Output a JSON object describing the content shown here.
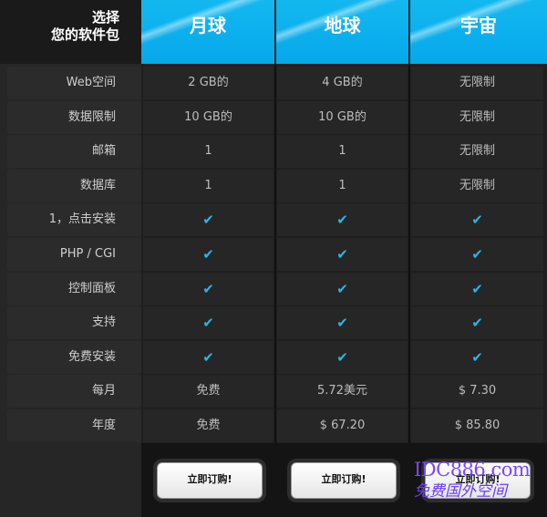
{
  "header": {
    "title_line1": "选择",
    "title_line2": "您的软件包",
    "plans": [
      "月球",
      "地球",
      "宇宙"
    ]
  },
  "rows": [
    {
      "label": "Web空间",
      "values": [
        "2 GB的",
        "4 GB的",
        "无限制"
      ]
    },
    {
      "label": "数据限制",
      "values": [
        "10 GB的",
        "10 GB的",
        "无限制"
      ]
    },
    {
      "label": "邮箱",
      "values": [
        "1",
        "1",
        "无限制"
      ]
    },
    {
      "label": "数据库",
      "values": [
        "1",
        "1",
        "无限制"
      ]
    },
    {
      "label": "1，点击安装",
      "values": [
        "✔",
        "✔",
        "✔"
      ]
    },
    {
      "label": "PHP / CGI",
      "values": [
        "✔",
        "✔",
        "✔"
      ]
    },
    {
      "label": "控制面板",
      "values": [
        "✔",
        "✔",
        "✔"
      ]
    },
    {
      "label": "支持",
      "values": [
        "✔",
        "✔",
        "✔"
      ]
    },
    {
      "label": "免费安装",
      "values": [
        "✔",
        "✔",
        "✔"
      ]
    },
    {
      "label": "每月",
      "values": [
        "免费",
        "5.72美元",
        "$ 7.30"
      ]
    },
    {
      "label": "年度",
      "values": [
        "免费",
        "$ 67.20",
        "$ 85.80"
      ]
    }
  ],
  "buttons": {
    "order_label": "立即订购!"
  },
  "watermark": {
    "line1": "IDC886.com",
    "line2": "免费国外空间"
  },
  "colors": {
    "accent": "#06a8ea",
    "check": "#29b6ea",
    "background": "#222222"
  },
  "icons": {
    "check": "checkmark-icon"
  }
}
